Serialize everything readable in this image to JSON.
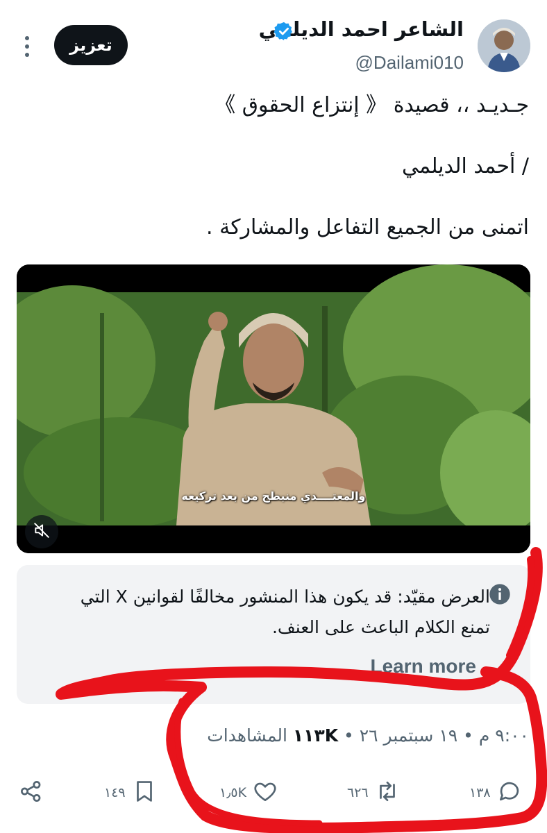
{
  "header": {
    "display_name": "الشاعر احمد الديلمي",
    "handle": "@Dailami010",
    "boost_label": "تعزيز"
  },
  "tweet": {
    "lines": [
      "جـديـد ،، قصيدة 《 إنتزاع الحقوق 》",
      "/ أحمد الديلمي",
      "اتمنى من الجميع التفاعل والمشاركة ."
    ]
  },
  "media": {
    "subtitle": "والمعتــــدي منبطح من بعد تركيعه"
  },
  "notice": {
    "text": "العرض مقيّد: قد يكون هذا المنشور مخالفًا لقوانين X التي تمنع الكلام الباعث على العنف.",
    "learn_more": "Learn more"
  },
  "meta": {
    "time": "٩:٠٠ م",
    "date": "١٩ سبتمبر ٢٦",
    "views_count": "١١٣K",
    "views_label": "المشاهدات"
  },
  "actions": {
    "replies": "١٣٨",
    "reposts": "٦٢٦",
    "likes": "١٫٥K",
    "bookmarks": "١٤٩"
  },
  "colors": {
    "text_primary": "#0f1419",
    "text_secondary": "#536471",
    "verified_blue": "#1d9bf0",
    "annotation_red": "#e8131b"
  },
  "icons": [
    "verified-badge-icon",
    "more-dots-icon",
    "mute-icon",
    "info-icon",
    "reply-icon",
    "repost-icon",
    "like-icon",
    "bookmark-icon",
    "share-icon"
  ]
}
